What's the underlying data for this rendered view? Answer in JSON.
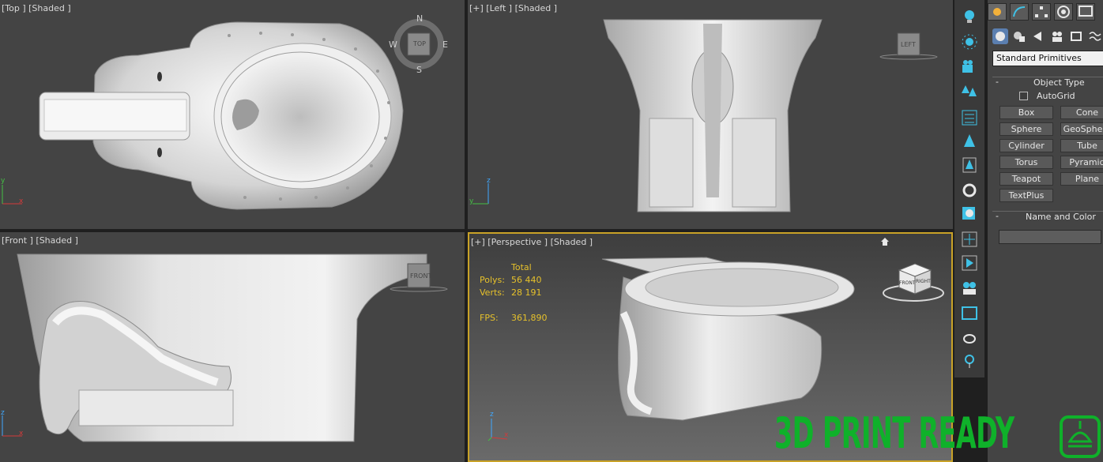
{
  "viewports": {
    "top": {
      "label": "[Top ] [Shaded ]",
      "cube_face": "TOP",
      "compass": {
        "n": "N",
        "s": "S",
        "e": "E",
        "w": "W"
      }
    },
    "left": {
      "label": "[+] [Left ] [Shaded ]",
      "cube_face": "LEFT"
    },
    "front": {
      "label": "[Front ] [Shaded ]",
      "cube_face": "FRONT"
    },
    "perspective": {
      "label": "[+] [Perspective ] [Shaded ]",
      "stats": {
        "header": "Total",
        "polys_label": "Polys:",
        "polys_value": "56 440",
        "verts_label": "Verts:",
        "verts_value": "28 191",
        "fps_label": "FPS:",
        "fps_value": "361,890"
      },
      "cube_faces": {
        "front": "FRONT",
        "right": "RIGHT"
      }
    },
    "axes": {
      "x": "x",
      "y": "y",
      "z": "z"
    }
  },
  "command_panel": {
    "dropdown_value": "Standard Primitives",
    "object_type": {
      "title": "Object Type",
      "autogrid_label": "AutoGrid",
      "buttons": [
        "Box",
        "Cone",
        "Sphere",
        "GeoSphere",
        "Cylinder",
        "Tube",
        "Torus",
        "Pyramid",
        "Teapot",
        "Plane",
        "TextPlus"
      ]
    },
    "name_and_color": {
      "title": "Name and Color"
    },
    "rollout_minus": "-"
  },
  "watermark": {
    "text": "3D PRINT READY",
    "color": "#0fb12a"
  },
  "colors": {
    "viewport_bg": "#444444",
    "active_border": "#c9a227",
    "stats_text": "#e6c12b"
  }
}
